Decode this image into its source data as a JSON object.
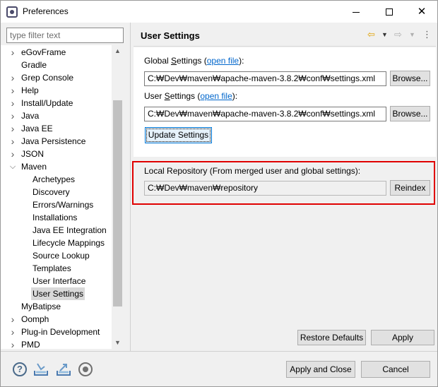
{
  "window": {
    "title": "Preferences",
    "minimize_glyph": "",
    "close_glyph": "✕"
  },
  "filter": {
    "placeholder": "type filter text",
    "value": ""
  },
  "tree": {
    "items": [
      {
        "label": "eGovFrame",
        "expandable": true,
        "expanded": false,
        "level": 0
      },
      {
        "label": "Gradle",
        "expandable": false,
        "expanded": false,
        "level": 0
      },
      {
        "label": "Grep Console",
        "expandable": true,
        "expanded": false,
        "level": 0
      },
      {
        "label": "Help",
        "expandable": true,
        "expanded": false,
        "level": 0
      },
      {
        "label": "Install/Update",
        "expandable": true,
        "expanded": false,
        "level": 0
      },
      {
        "label": "Java",
        "expandable": true,
        "expanded": false,
        "level": 0
      },
      {
        "label": "Java EE",
        "expandable": true,
        "expanded": false,
        "level": 0
      },
      {
        "label": "Java Persistence",
        "expandable": true,
        "expanded": false,
        "level": 0
      },
      {
        "label": "JSON",
        "expandable": true,
        "expanded": false,
        "level": 0
      },
      {
        "label": "Maven",
        "expandable": true,
        "expanded": true,
        "level": 0
      },
      {
        "label": "Archetypes",
        "expandable": false,
        "expanded": false,
        "level": 1
      },
      {
        "label": "Discovery",
        "expandable": false,
        "expanded": false,
        "level": 1
      },
      {
        "label": "Errors/Warnings",
        "expandable": false,
        "expanded": false,
        "level": 1
      },
      {
        "label": "Installations",
        "expandable": false,
        "expanded": false,
        "level": 1
      },
      {
        "label": "Java EE Integration",
        "expandable": false,
        "expanded": false,
        "level": 1
      },
      {
        "label": "Lifecycle Mappings",
        "expandable": false,
        "expanded": false,
        "level": 1
      },
      {
        "label": "Source Lookup",
        "expandable": false,
        "expanded": false,
        "level": 1
      },
      {
        "label": "Templates",
        "expandable": false,
        "expanded": false,
        "level": 1
      },
      {
        "label": "User Interface",
        "expandable": false,
        "expanded": false,
        "level": 1
      },
      {
        "label": "User Settings",
        "expandable": false,
        "expanded": false,
        "level": 1,
        "selected": true
      },
      {
        "label": "MyBatipse",
        "expandable": false,
        "expanded": false,
        "level": 0
      },
      {
        "label": "Oomph",
        "expandable": true,
        "expanded": false,
        "level": 0
      },
      {
        "label": "Plug-in Development",
        "expandable": true,
        "expanded": false,
        "level": 0
      },
      {
        "label": "PMD",
        "expandable": true,
        "expanded": false,
        "level": 0
      }
    ]
  },
  "page": {
    "title": "User Settings",
    "global_settings": {
      "label_prefix": "Global ",
      "label_underlined": "S",
      "label_rest": "ettings (",
      "link": "open file",
      "label_suffix": "):",
      "path": "C:₩Dev₩maven₩apache-maven-3.8.2₩conf₩settings.xml",
      "browse_label": "Browse..."
    },
    "user_settings": {
      "label_prefix": "User ",
      "label_underlined": "S",
      "label_rest": "ettings (",
      "link": "open file",
      "label_suffix": "):",
      "path": "C:₩Dev₩maven₩apache-maven-3.8.2₩conf₩settings.xml",
      "browse_label": "Browse..."
    },
    "update_button": "Update Settings",
    "local_repo": {
      "label": "Local Repository (From merged user and global settings):",
      "path": "C:₩Dev₩maven₩repository",
      "reindex_label": "Reindex"
    },
    "restore_defaults": "Restore Defaults",
    "apply": "Apply"
  },
  "footer": {
    "apply_close": "Apply and Close",
    "cancel": "Cancel",
    "icons": [
      "help-icon",
      "import-icon",
      "export-icon",
      "record-icon"
    ]
  },
  "colors": {
    "highlight_border": "#e00000",
    "link": "#0066cc",
    "focus": "#0078d7"
  }
}
